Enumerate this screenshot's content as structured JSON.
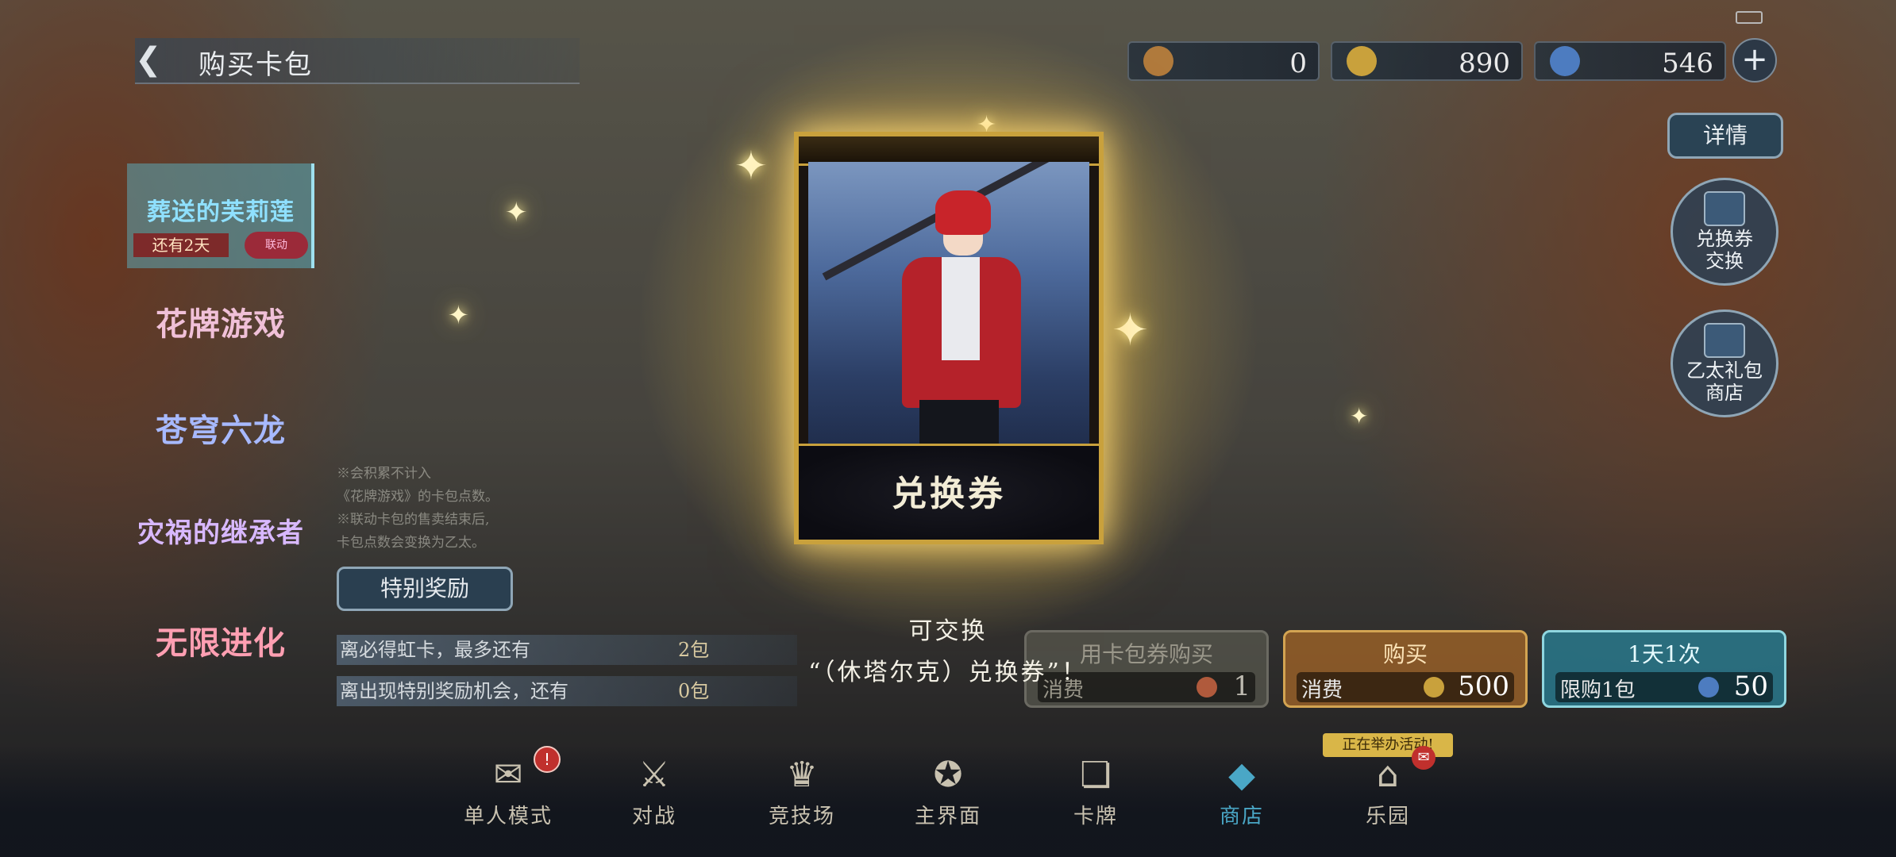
{
  "header": {
    "back_icon": "back-arrow-icon",
    "title": "购买卡包"
  },
  "currencies": [
    {
      "name": "pack-ticket",
      "value": "0",
      "color": "#b07a3c"
    },
    {
      "name": "gold",
      "value": "890",
      "color": "#c9a13c"
    },
    {
      "name": "crystal",
      "value": "546",
      "color": "#4d7cc0"
    }
  ],
  "right_buttons": {
    "detail": "详情",
    "exchange_ticket": [
      "兑换券",
      "交换"
    ],
    "ether_shop": [
      "乙太礼包",
      "商店"
    ]
  },
  "packs": [
    {
      "label": "葬送的芙莉莲",
      "color": "#8fe0ff",
      "selected": true,
      "tag": "还有2天",
      "tag2": "联动"
    },
    {
      "label": "花牌游戏",
      "color": "#f0c0d8",
      "selected": false
    },
    {
      "label": "苍穹六龙",
      "color": "#a7b9ff",
      "selected": false
    },
    {
      "label": "灾祸的继承者",
      "color": "#d8b8ff",
      "selected": false
    },
    {
      "label": "无限进化",
      "color": "#ff9fb2",
      "selected": false
    }
  ],
  "notes": [
    "※会积累不计入",
    "《花牌游戏》的卡包点数。",
    "※联动卡包的售卖结束后,",
    "卡包点数会变换为乙太。"
  ],
  "special_reward": "特别奖励",
  "info_rows": [
    {
      "label": "离必得虹卡，最多还有",
      "value": "2包"
    },
    {
      "label": "离出现特别奖励机会，还有",
      "value": "0包"
    }
  ],
  "card": {
    "banner": "兑换券"
  },
  "exchange_message": {
    "line1": "可交换",
    "line2": "“（休塔尔克）兑换券”！"
  },
  "buy_panels": [
    {
      "head": "用卡包券购买",
      "cost_label": "消费",
      "value": "1",
      "border": "#6b6a62",
      "bg": "rgba(90,90,80,0.7)",
      "head_color": "#9a978a",
      "icon_color": "#b05a3c"
    },
    {
      "head": "购买",
      "cost_label": "消费",
      "value": "500",
      "border": "#d3a452",
      "bg": "rgba(150,95,40,0.85)",
      "head_color": "#fbe2b6",
      "icon_color": "#c9a13c"
    },
    {
      "head": "1天1次",
      "cost_label": "限购1包",
      "value": "50",
      "border": "#8fd6df",
      "bg": "rgba(40,120,140,0.85)",
      "head_color": "#e6fbff",
      "icon_color": "#4d7cc0"
    }
  ],
  "nav": [
    {
      "label": "单人模式",
      "icon": "solo-mode-icon",
      "glyph": "✉",
      "active": false
    },
    {
      "label": "对战",
      "icon": "crossed-swords-icon",
      "glyph": "⚔",
      "active": false
    },
    {
      "label": "竞技场",
      "icon": "trophy-icon",
      "glyph": "♛",
      "active": false
    },
    {
      "label": "主界面",
      "icon": "home-compass-icon",
      "glyph": "✪",
      "active": false
    },
    {
      "label": "卡牌",
      "icon": "cards-icon",
      "glyph": "❏",
      "active": false
    },
    {
      "label": "商店",
      "icon": "shop-icon",
      "glyph": "◆",
      "active": true
    },
    {
      "label": "乐园",
      "icon": "paradise-icon",
      "glyph": "⌂",
      "active": false
    }
  ],
  "nav_badge": "!",
  "event_tag": "正在举办活动!"
}
